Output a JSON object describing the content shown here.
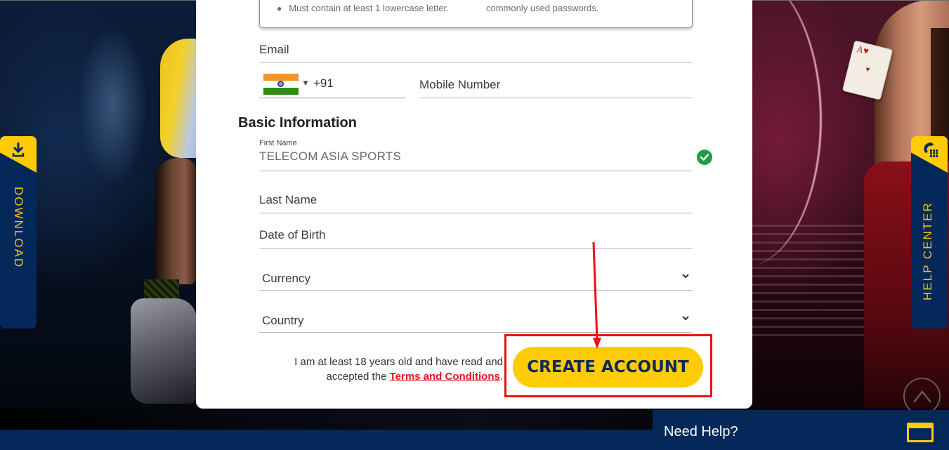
{
  "password_rules": {
    "left": "Must contain at least 1 lowercase letter.",
    "right": "commonly used passwords."
  },
  "contact": {
    "email_placeholder": "Email",
    "country_code": "+91",
    "country_flag": "india-flag",
    "mobile_placeholder": "Mobile Number"
  },
  "basic_info": {
    "title": "Basic Information",
    "first_name_label": "First Name",
    "first_name_value": "TELECOM ASIA SPORTS",
    "first_name_valid": true,
    "last_name_placeholder": "Last Name",
    "dob_placeholder": "Date of Birth",
    "currency_placeholder": "Currency",
    "country_placeholder": "Country"
  },
  "terms": {
    "text_before": "I am at least 18 years old and have read and accepted the ",
    "link_label": "Terms and Conditions",
    "text_after": "."
  },
  "create_account_label": "CREATE ACCOUNT",
  "side_tabs": {
    "download_label": "DOWNLOAD",
    "help_center_label": "HELP CENTER"
  },
  "need_help_label": "Need Help?",
  "colors": {
    "brand_navy": "#04285a",
    "brand_yellow": "#ffcb05",
    "link_red": "#e0161b",
    "valid_green": "#1e9e47",
    "annotation_red": "#ee1111"
  }
}
